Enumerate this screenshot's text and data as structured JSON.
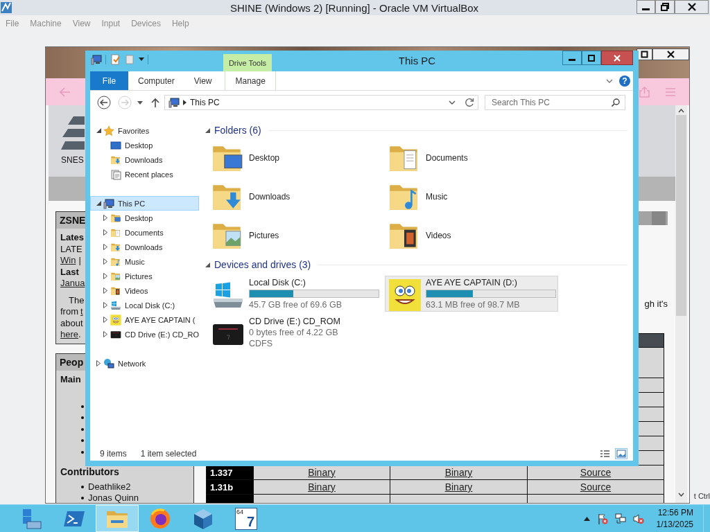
{
  "host": {
    "title": "SHINE (Windows 2) [Running] - Oracle VM VirtualBox",
    "menu": [
      "File",
      "Machine",
      "View",
      "Input",
      "Devices",
      "Help"
    ]
  },
  "browser": {
    "logo_caption": "SNES",
    "news_box": {
      "title": "ZSNE",
      "lines": [
        [
          {
            "kind": "bold",
            "text": "Lates"
          }
        ],
        [
          {
            "kind": "text",
            "text": "LATE"
          }
        ],
        [
          {
            "kind": "link",
            "text": "Win"
          },
          {
            "kind": "text",
            "text": "|"
          }
        ],
        [
          {
            "kind": "bold",
            "text": "Last"
          }
        ],
        [
          {
            "kind": "link",
            "text": "Janua"
          }
        ]
      ],
      "paragraph": [
        [
          {
            "kind": "text",
            "text": "The"
          }
        ],
        [
          {
            "kind": "text",
            "text": "from"
          },
          {
            "kind": "link",
            "text": "t"
          }
        ],
        [
          {
            "kind": "text",
            "text": "about"
          }
        ],
        [
          {
            "kind": "link",
            "text": "here"
          },
          {
            "kind": "text",
            "text": "."
          }
        ]
      ]
    },
    "people_box": {
      "title": "Peop",
      "heading": "Main",
      "contributors_heading": "Contributors",
      "contributors": [
        "Deathlike2",
        "Jonas Quinn"
      ]
    },
    "side_text": "gh it's",
    "downloads_table": {
      "rows": [
        [
          "1.337",
          "Binary",
          "Binary",
          "Source"
        ],
        [
          "1.31b",
          "Binary",
          "Binary",
          "Source"
        ]
      ]
    }
  },
  "explorer": {
    "title": "This PC",
    "contextual_group": "Drive Tools",
    "ribbon_tabs": [
      {
        "kind": "backstage",
        "label": "File",
        "selected": false
      },
      {
        "kind": "tab",
        "label": "Computer",
        "selected": false
      },
      {
        "kind": "tab",
        "label": "View",
        "selected": false
      },
      {
        "kind": "contextual",
        "label": "Manage",
        "selected": false
      }
    ],
    "help_button": "?",
    "back": {
      "disabled": false
    },
    "forward": {
      "disabled": true
    },
    "address": [
      "This PC"
    ],
    "search": {
      "placeholder": "Search This PC"
    },
    "nav": [
      {
        "kind": "favorites",
        "label": "Favorites",
        "expanded": true,
        "selected": false,
        "children": [
          {
            "kind": "desktop-shortcut",
            "label": "Desktop",
            "selected": false
          },
          {
            "kind": "downloads",
            "label": "Downloads",
            "selected": false
          },
          {
            "kind": "recent",
            "label": "Recent places",
            "selected": false
          }
        ]
      },
      {
        "kind": "pc",
        "label": "This PC",
        "expanded": true,
        "selected": true,
        "children": [
          {
            "kind": "desktop",
            "label": "Desktop",
            "expanded": false,
            "selected": false
          },
          {
            "kind": "documents",
            "label": "Documents",
            "expanded": false,
            "selected": false
          },
          {
            "kind": "downloads",
            "label": "Downloads",
            "expanded": false,
            "selected": false
          },
          {
            "kind": "music",
            "label": "Music",
            "expanded": false,
            "selected": false
          },
          {
            "kind": "pictures",
            "label": "Pictures",
            "expanded": false,
            "selected": false
          },
          {
            "kind": "videos",
            "label": "Videos",
            "expanded": false,
            "selected": false
          },
          {
            "kind": "local-disk",
            "label": "Local Disk (C:)",
            "expanded": false,
            "selected": false
          },
          {
            "kind": "removable",
            "label": "AYE AYE CAPTAIN (",
            "expanded": false,
            "selected": false
          },
          {
            "kind": "cd-drive",
            "label": "CD Drive (E:) CD_RO",
            "expanded": false,
            "selected": false
          }
        ]
      },
      {
        "kind": "network",
        "label": "Network",
        "expanded": false,
        "selected": false
      }
    ],
    "groups": [
      {
        "kind": "folders",
        "title": "Folders (6)",
        "expanded": true,
        "items": [
          {
            "kind": "desktop",
            "name": "Desktop",
            "selected": false
          },
          {
            "kind": "documents",
            "name": "Documents",
            "selected": false
          },
          {
            "kind": "downloads",
            "name": "Downloads",
            "selected": false
          },
          {
            "kind": "music",
            "name": "Music",
            "selected": false
          },
          {
            "kind": "pictures",
            "name": "Pictures",
            "selected": false
          },
          {
            "kind": "videos",
            "name": "Videos",
            "selected": false
          }
        ]
      },
      {
        "kind": "drives",
        "title": "Devices and drives (3)",
        "expanded": true,
        "items": [
          {
            "kind": "local-disk",
            "name": "Local Disk (C:)",
            "level": 0.34,
            "detail": "45.7 GB free of 69.6 GB",
            "selected": false
          },
          {
            "kind": "removable",
            "name": "AYE AYE CAPTAIN (D:)",
            "level": 0.36,
            "detail": "63.1 MB free of 98.7 MB",
            "selected": true
          },
          {
            "kind": "cd-drive",
            "name": "CD Drive (E:) CD_ROM",
            "detail": "0 bytes free of 4.22 GB",
            "filesystem": "CDFS",
            "selected": false
          }
        ]
      }
    ],
    "status": {
      "items": "9 items",
      "selection": "1 item selected"
    },
    "view_buttons": [
      {
        "kind": "details",
        "selected": false
      },
      {
        "kind": "large-icons",
        "selected": true
      }
    ]
  },
  "screen_edge_text": "t Ctrl",
  "taskbar": {
    "apps": [
      {
        "kind": "server-manager",
        "active": false
      },
      {
        "kind": "powershell",
        "active": false
      },
      {
        "kind": "file-explorer",
        "active": true
      },
      {
        "kind": "firefox",
        "active": false
      },
      {
        "kind": "virtualbox",
        "active": false
      },
      {
        "kind": "badge-app",
        "active": false,
        "badge": "64",
        "label": "7"
      }
    ],
    "clock": {
      "time": "12:56 PM",
      "date": "1/13/2025"
    }
  }
}
